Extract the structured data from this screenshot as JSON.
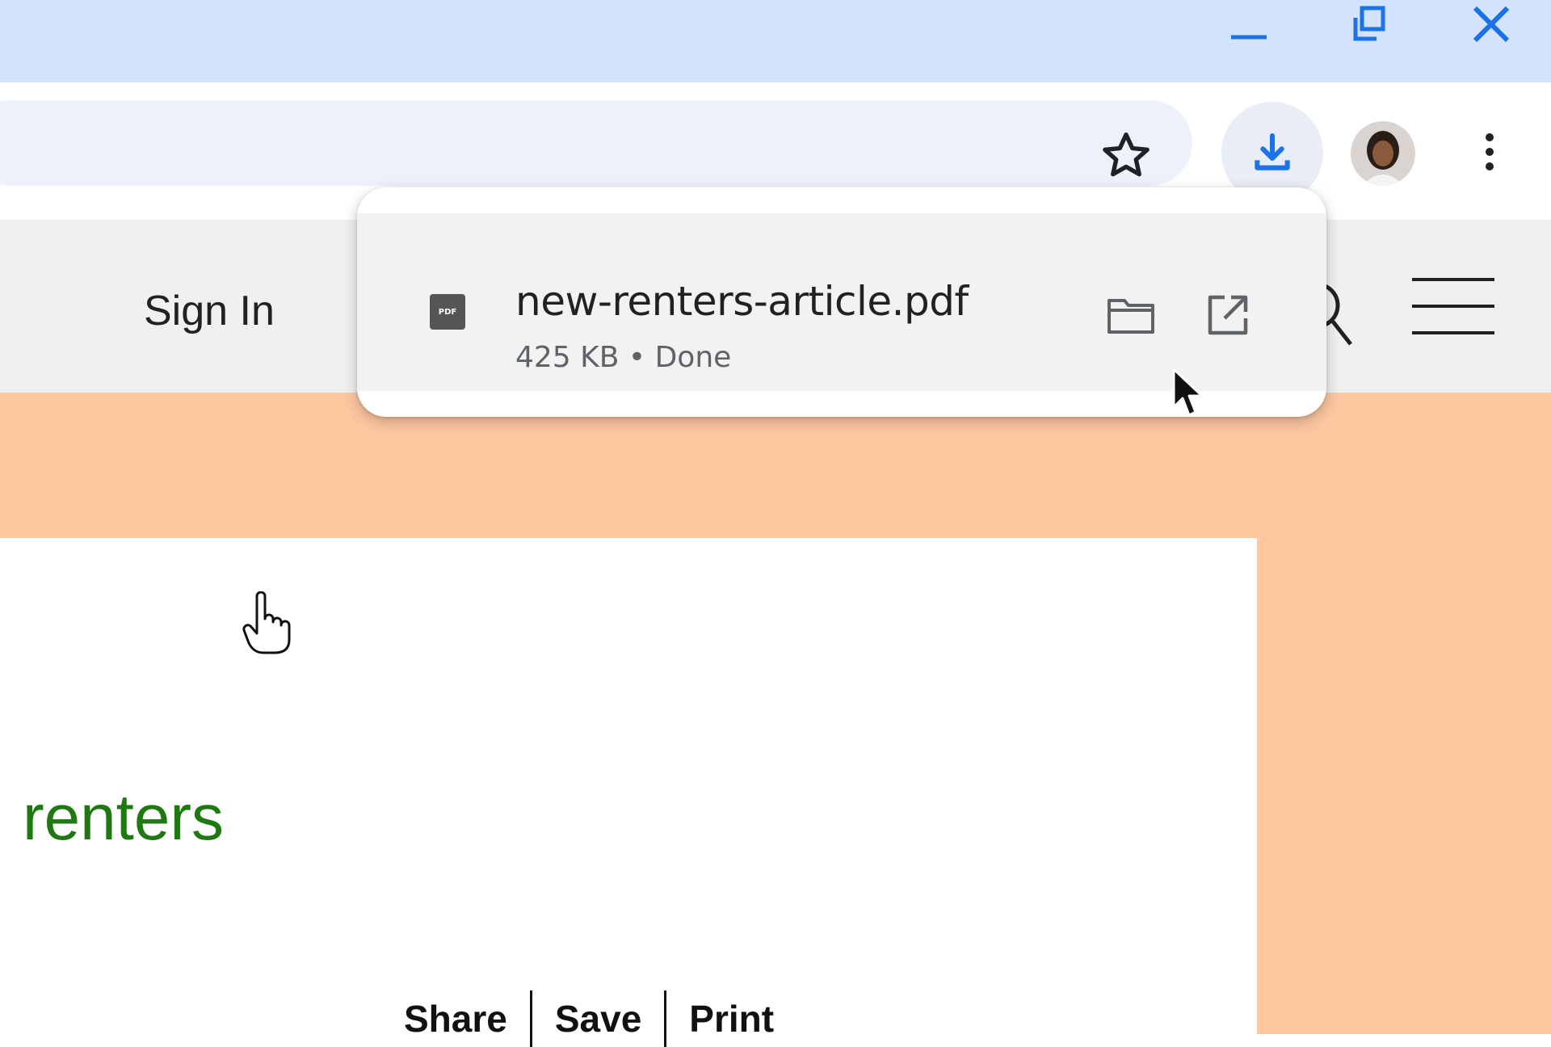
{
  "titlebar": {
    "minimize_icon": "minimize-icon",
    "restore_icon": "restore-icon",
    "close_icon": "close-icon"
  },
  "toolbar": {
    "bookmark_icon": "star-icon",
    "download_icon": "download-icon",
    "profile_icon": "avatar",
    "menu_icon": "more-vert-icon"
  },
  "site": {
    "sign_in": "Sign In",
    "search_icon": "search-icon",
    "menu_icon": "hamburger-icon"
  },
  "download_popup": {
    "file_type_icon": "pdf-file-icon",
    "file_type_label": "PDF",
    "filename": "new-renters-article.pdf",
    "meta": "425 KB • Done",
    "show_in_folder_icon": "folder-icon",
    "open_icon": "open-external-icon"
  },
  "article": {
    "heading_word": "renters",
    "actions": [
      "Share",
      "Save",
      "Print"
    ]
  },
  "colors": {
    "titlebar_bg": "#d3e3fd",
    "omnibox_bg": "#edf2fa",
    "download_accent": "#1a73e8",
    "hero_bg": "#fdc7a0",
    "heading_green": "#1e7a10"
  }
}
